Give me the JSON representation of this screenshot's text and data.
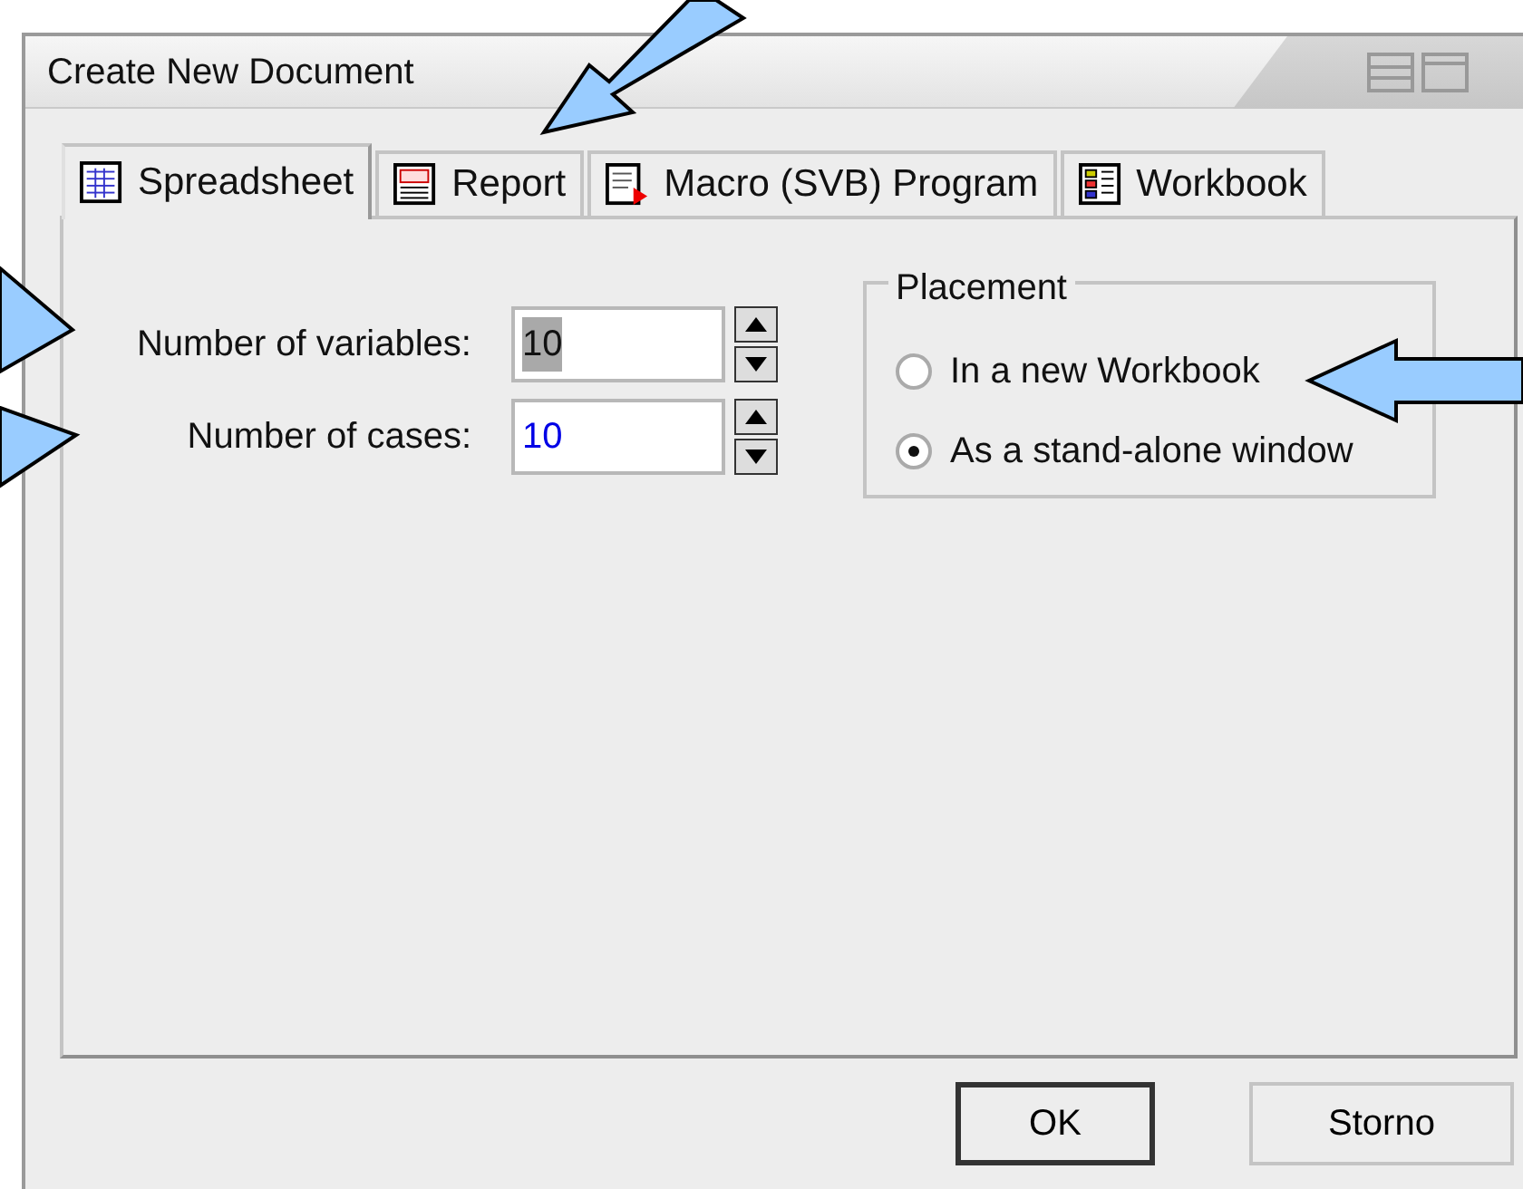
{
  "window": {
    "title": "Create New Document"
  },
  "tabs": [
    {
      "label": "Spreadsheet",
      "kind": "spreadsheet",
      "selected": true
    },
    {
      "label": "Report",
      "kind": "report",
      "selected": false
    },
    {
      "label": "Macro (SVB) Program",
      "kind": "macro",
      "selected": false
    },
    {
      "label": "Workbook",
      "kind": "workbook",
      "selected": false
    }
  ],
  "fields": [
    {
      "label": "Number of variables:",
      "value": "10",
      "text_selected": true
    },
    {
      "label": "Number of cases:",
      "value": "10",
      "text_selected": false
    }
  ],
  "placement": {
    "title": "Placement",
    "options": [
      {
        "label": "In a new Workbook",
        "selected": false
      },
      {
        "label": "As a stand-alone window",
        "selected": true
      }
    ]
  },
  "buttons": [
    {
      "label": "OK",
      "default": true
    },
    {
      "label": "Storno",
      "default": false
    }
  ]
}
